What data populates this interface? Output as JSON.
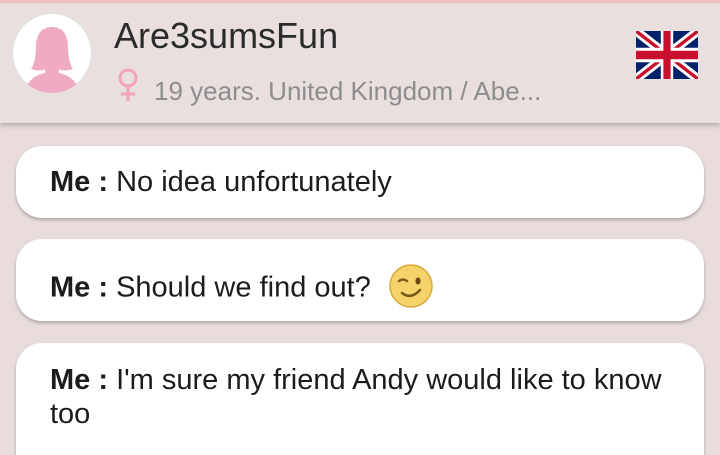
{
  "header": {
    "username": "Are3sumsFun",
    "subline": "19 years. United Kingdom / Abe...",
    "avatar_icon": "female-silhouette-icon",
    "gender_icon": "female-symbol-icon",
    "flag_icon": "uk-flag-icon"
  },
  "messages": [
    {
      "sender": "Me",
      "separator": " : ",
      "text": "No idea unfortunately"
    },
    {
      "sender": "Me",
      "separator": " : ",
      "text": "Should we find out?",
      "emoji": "winking-face-emoji"
    },
    {
      "sender": "Me",
      "separator": " : ",
      "text": "I'm sure my friend Andy would like to know too"
    }
  ],
  "colors": {
    "background": "#e8dcdc",
    "avatar_pink": "#f0aac4",
    "gender_pink": "#f3a2bb",
    "bubble": "#ffffff"
  }
}
